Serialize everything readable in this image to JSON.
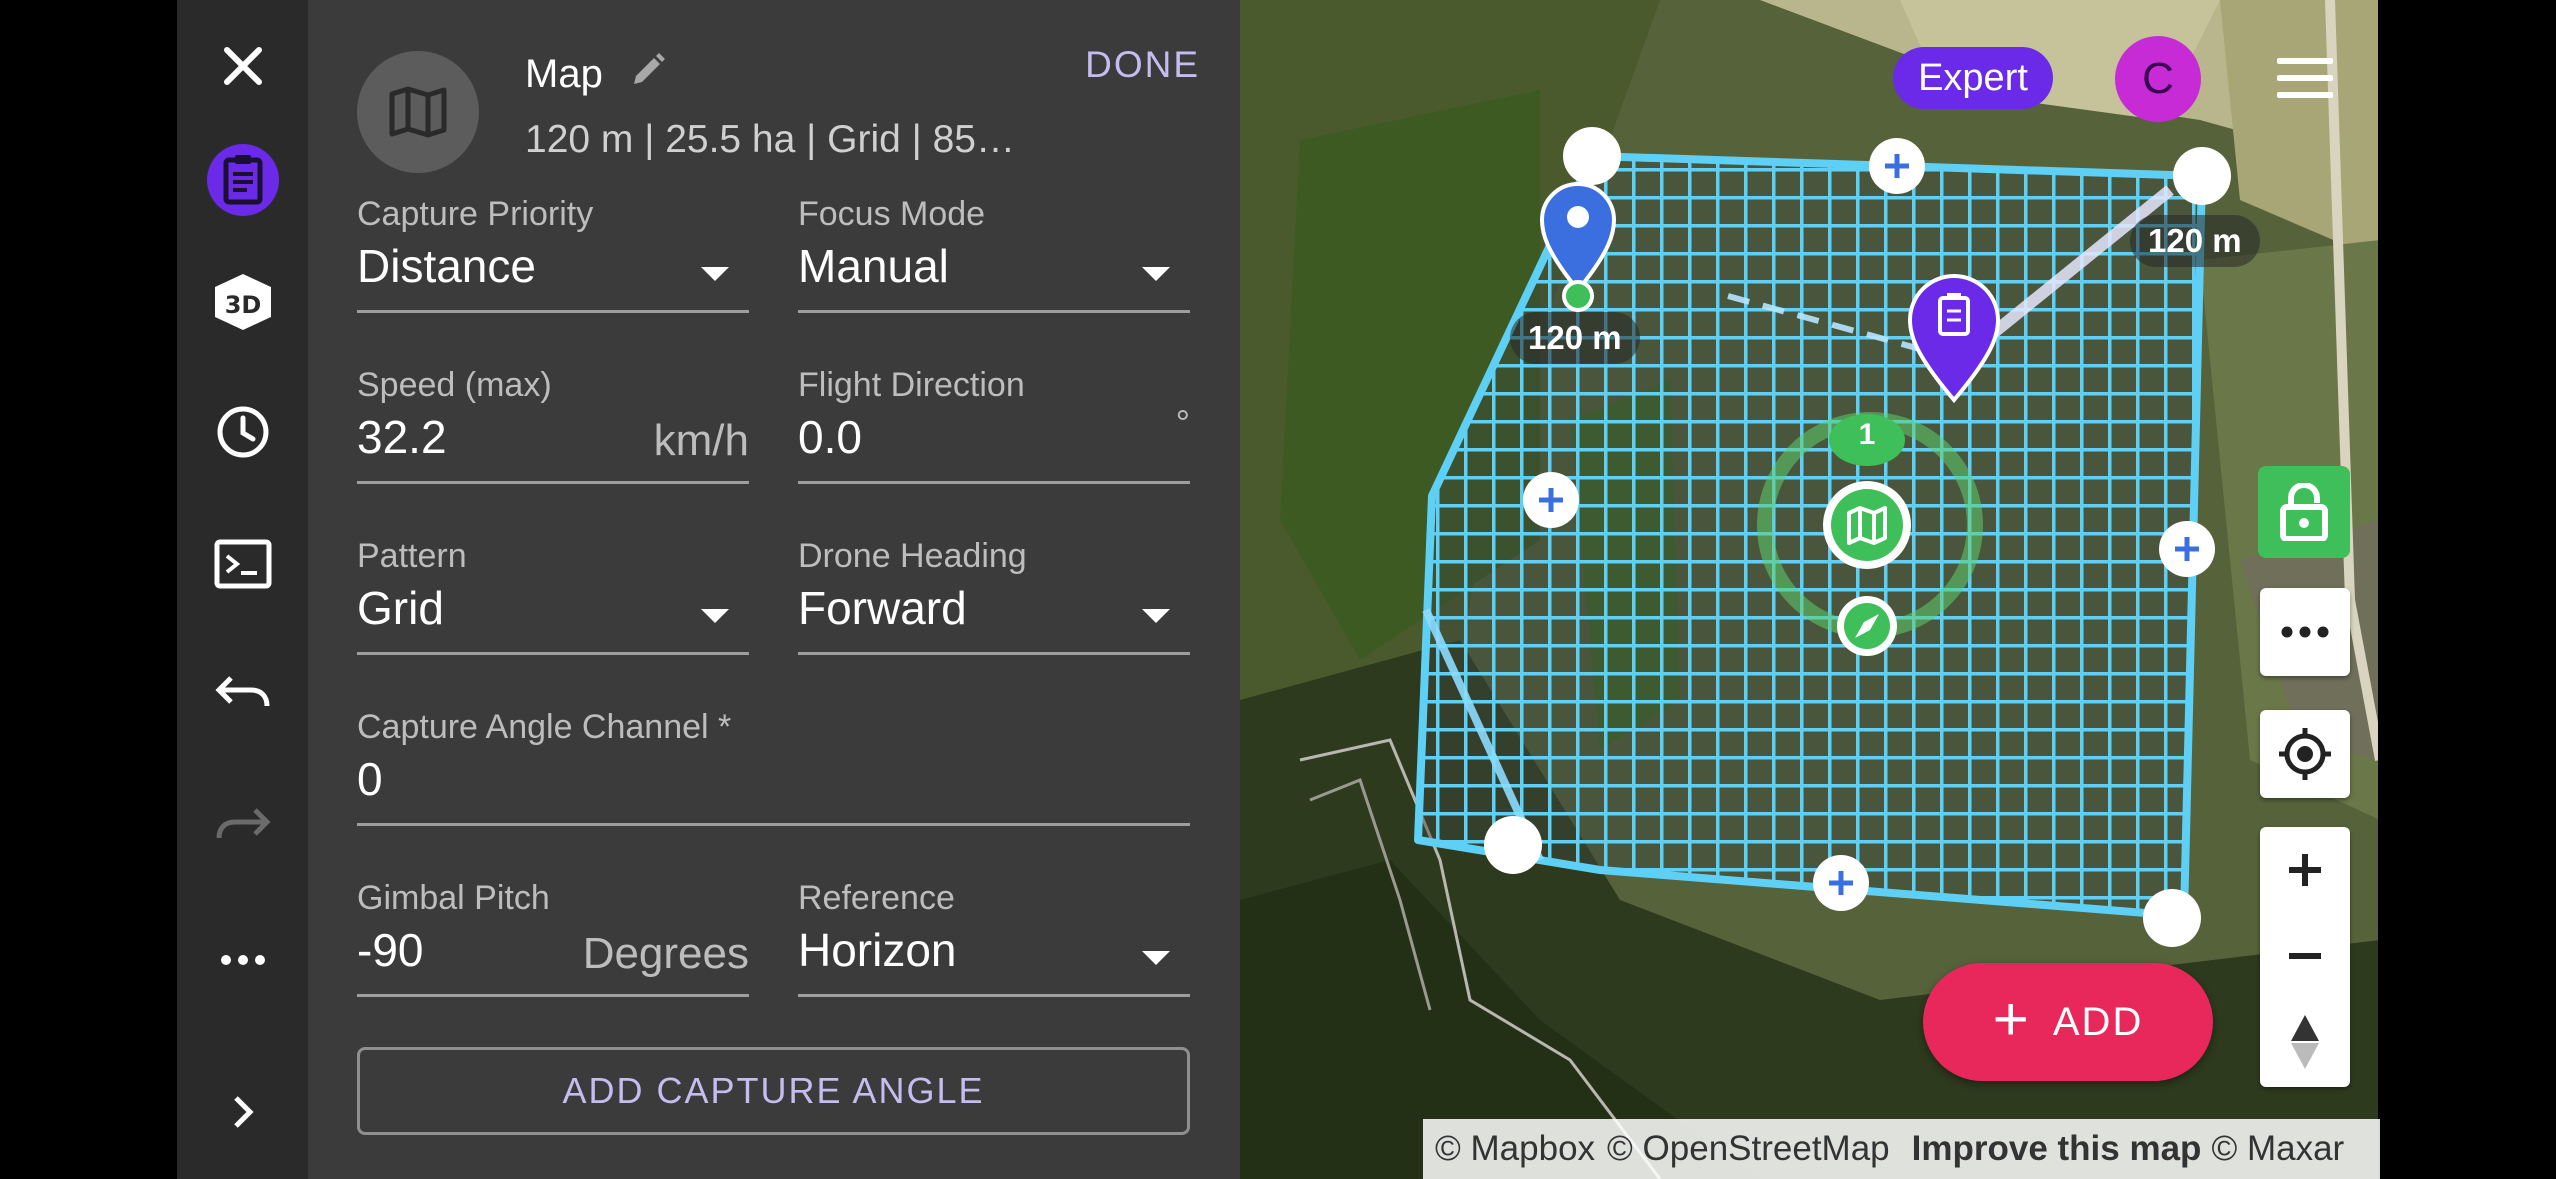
{
  "panel": {
    "title": "Map",
    "summary": "120 m | 25.5 ha | Grid | 85…",
    "done_label": "DONE",
    "fields": {
      "capture_priority": {
        "label": "Capture Priority",
        "value": "Distance"
      },
      "focus_mode": {
        "label": "Focus Mode",
        "value": "Manual"
      },
      "speed": {
        "label": "Speed (max)",
        "value": "32.2",
        "unit": "km/h"
      },
      "flight_direction": {
        "label": "Flight Direction",
        "value": "0.0",
        "unit": "°"
      },
      "pattern": {
        "label": "Pattern",
        "value": "Grid"
      },
      "drone_heading": {
        "label": "Drone Heading",
        "value": "Forward"
      },
      "capture_angle_channel": {
        "label": "Capture Angle Channel *",
        "value": "0"
      },
      "gimbal_pitch": {
        "label": "Gimbal Pitch",
        "value": "-90",
        "unit": "Degrees"
      },
      "reference": {
        "label": "Reference",
        "value": "Horizon"
      }
    },
    "add_capture_angle_label": "ADD CAPTURE ANGLE"
  },
  "rail": {
    "items": [
      "close-icon",
      "mission-icon",
      "3d-icon",
      "history-icon",
      "terminal-icon",
      "undo-icon",
      "redo-icon",
      "more-icon",
      "expand-icon"
    ]
  },
  "map": {
    "expert_label": "Expert",
    "avatar_initial": "C",
    "distance_labels": [
      "120 m",
      "120 m"
    ],
    "waypoint_number": "1",
    "add_label": "ADD",
    "attribution": {
      "mapbox": "© Mapbox",
      "osm": "© OpenStreetMap",
      "improve": "Improve this map",
      "maxar": "© Maxar"
    }
  },
  "colors": {
    "accent": "#6a2ae8",
    "grid": "#5fd0f5",
    "add_button": "#e8285a",
    "lock_green": "#3fbf5a",
    "panel_bg": "#3b3b3b",
    "rail_bg": "#2a2a2a"
  }
}
